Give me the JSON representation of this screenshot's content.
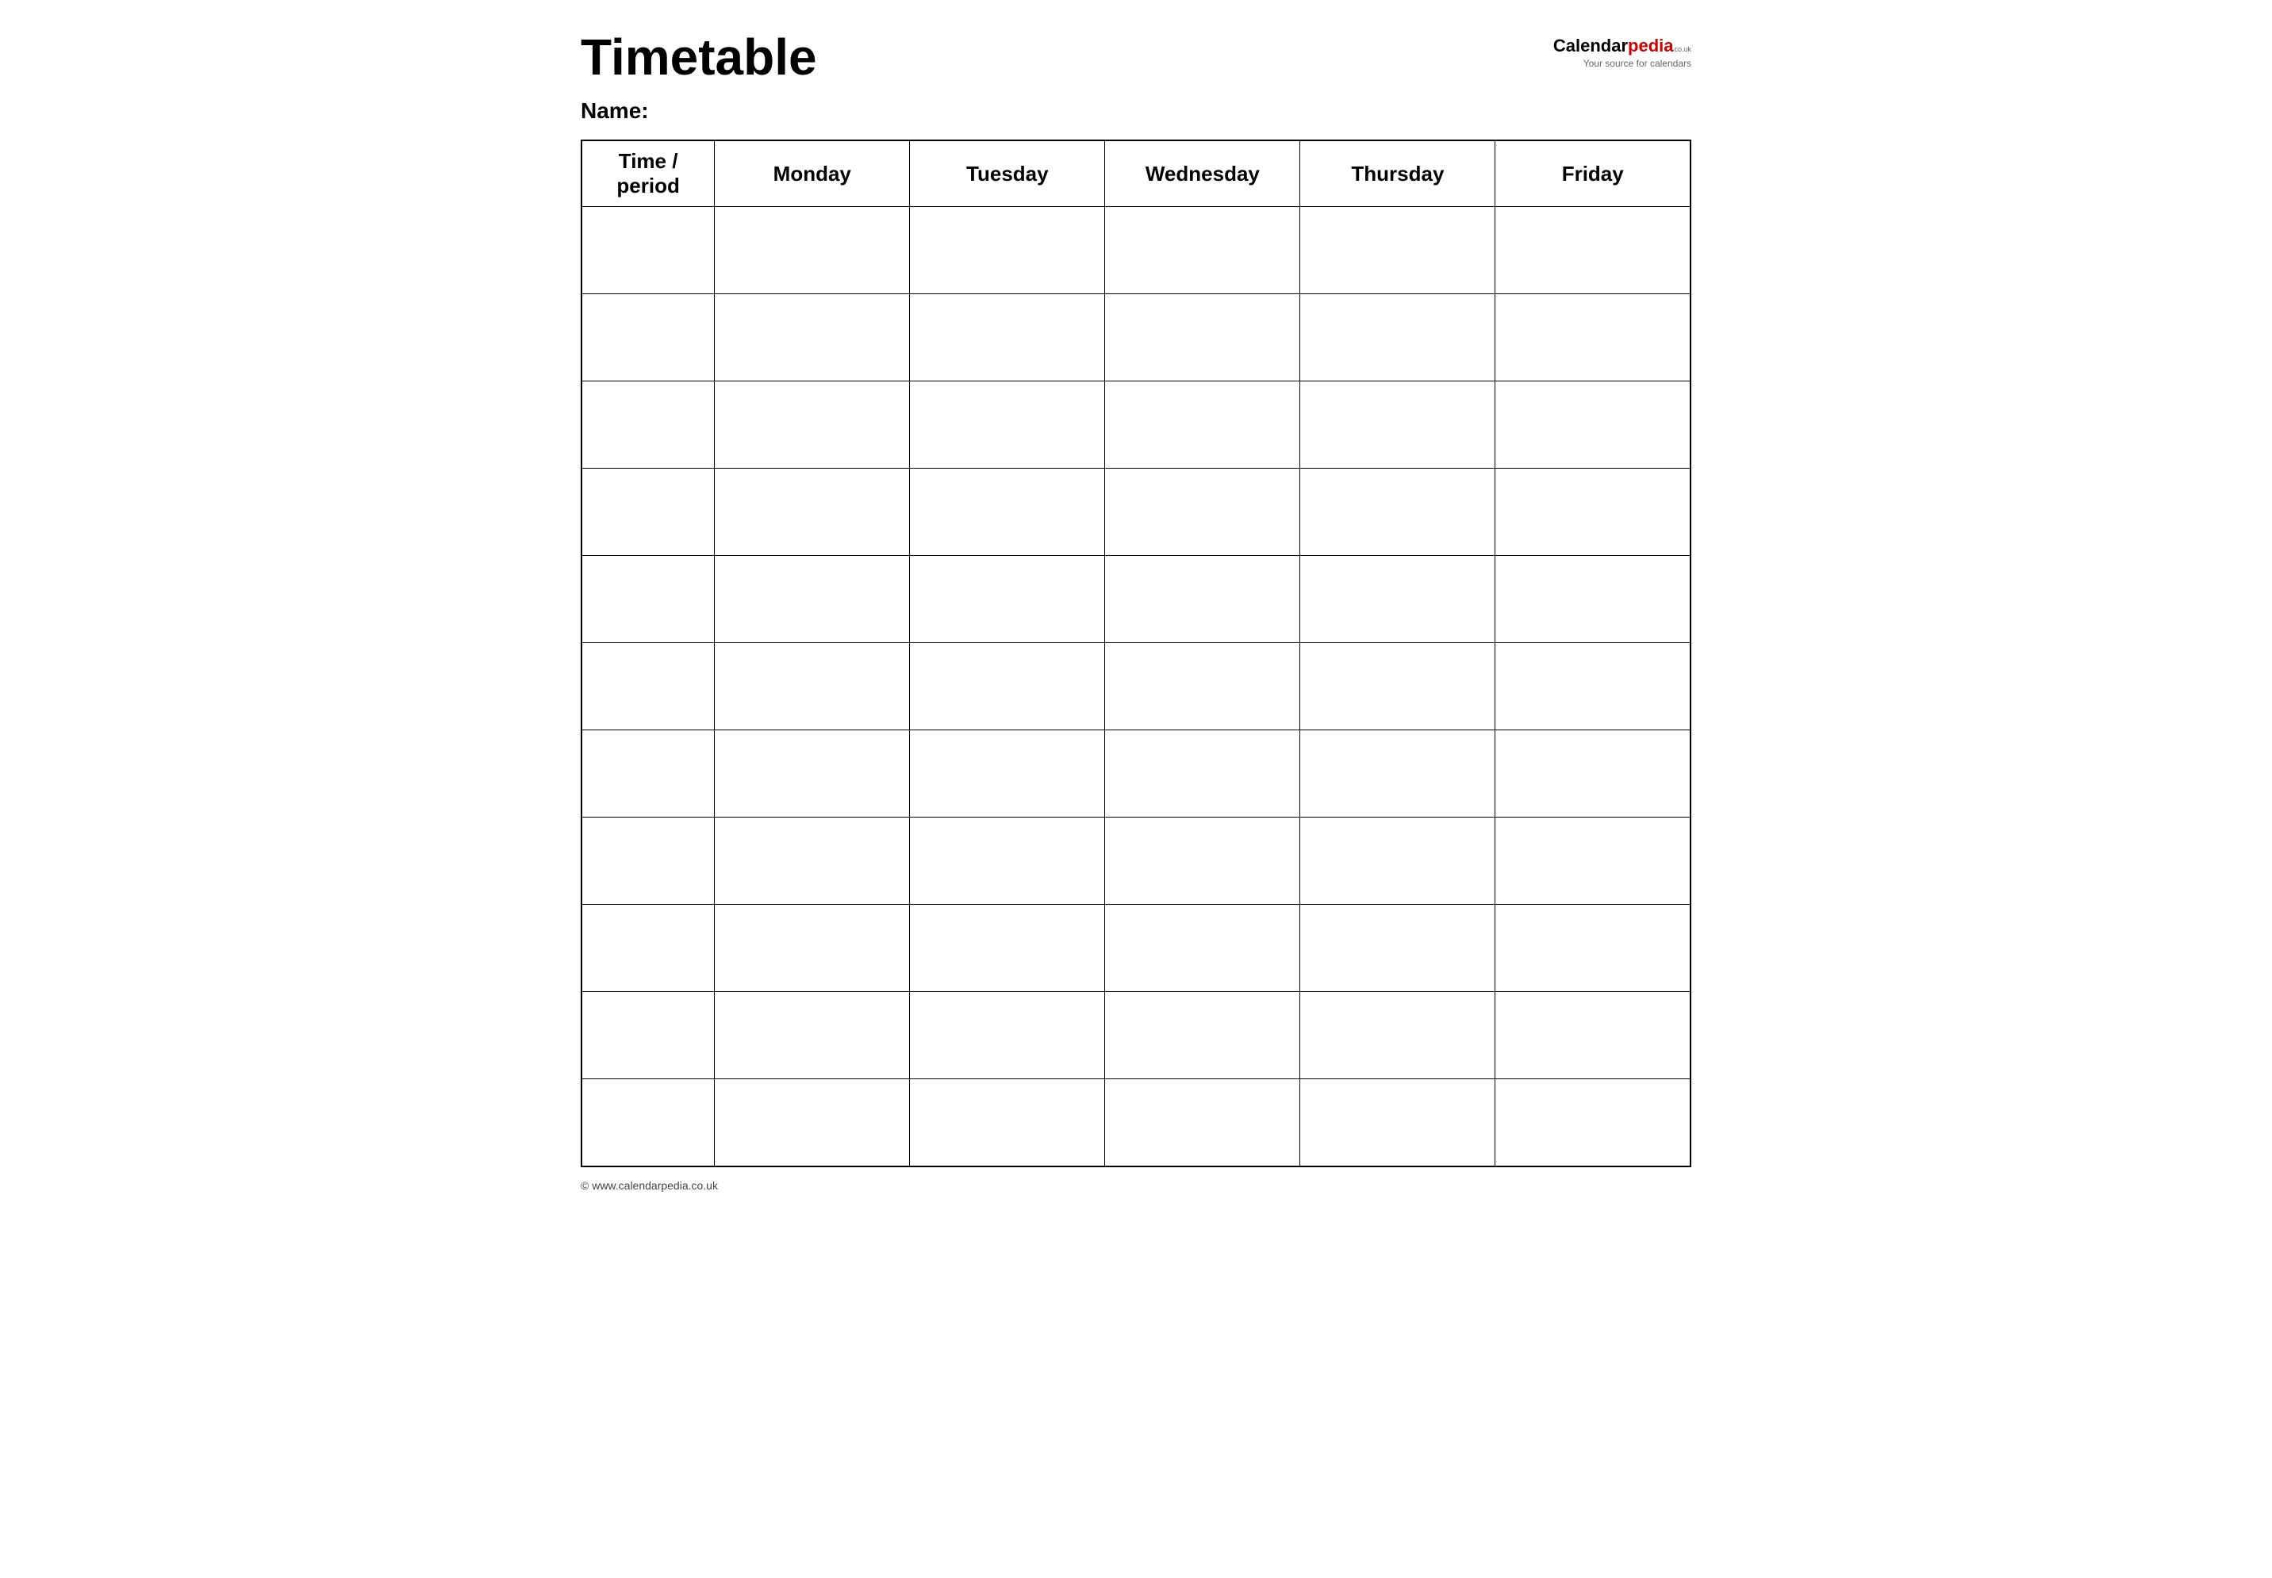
{
  "header": {
    "title": "Timetable",
    "logo": {
      "calendar_text": "Calendar",
      "pedia_text": "pedia",
      "couk": "co.uk",
      "subtitle": "Your source for calendars"
    }
  },
  "name_label": "Name:",
  "table": {
    "columns": [
      {
        "key": "time",
        "label": "Time / period"
      },
      {
        "key": "monday",
        "label": "Monday"
      },
      {
        "key": "tuesday",
        "label": "Tuesday"
      },
      {
        "key": "wednesday",
        "label": "Wednesday"
      },
      {
        "key": "thursday",
        "label": "Thursday"
      },
      {
        "key": "friday",
        "label": "Friday"
      }
    ],
    "row_count": 11
  },
  "footer": {
    "url": "© www.calendarpedia.co.uk"
  }
}
